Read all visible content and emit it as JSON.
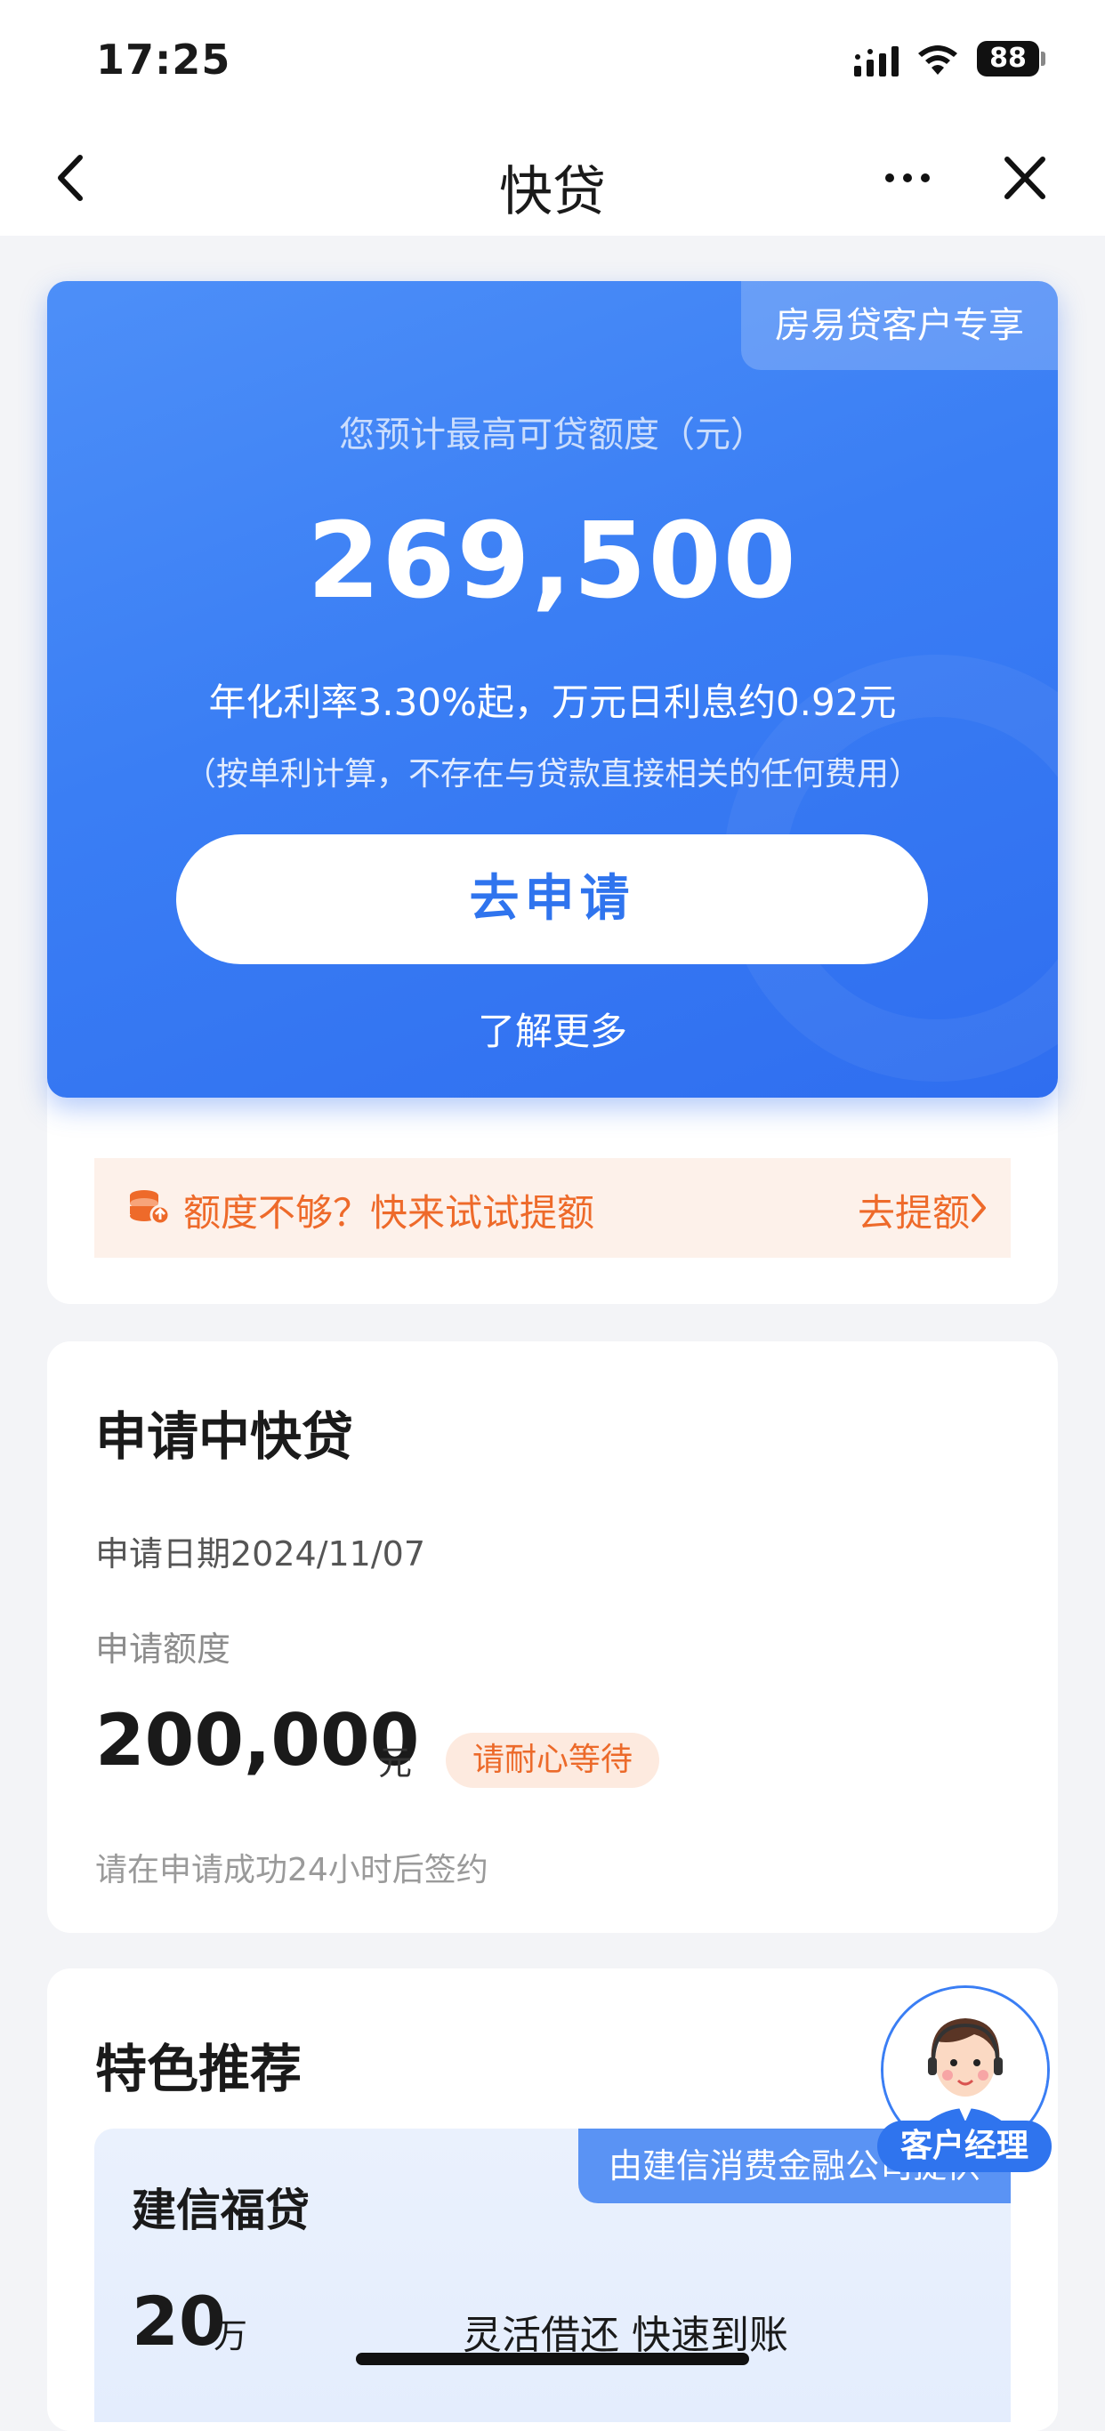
{
  "status_bar": {
    "time": "17:25",
    "battery": "88"
  },
  "nav": {
    "title": "快贷",
    "back_icon": "chevron-left-icon",
    "more_icon": "more-dots-icon",
    "close_icon": "close-icon"
  },
  "quota_card": {
    "tag": "房易贷客户专享",
    "label": "您预计最高可贷额度（元）",
    "amount": "269,500",
    "rate_line": "年化利率3.30%起，万元日利息约0.92元",
    "rate_note": "（按单利计算，不存在与贷款直接相关的任何费用）",
    "apply_button": "去申请",
    "learn_more": "了解更多"
  },
  "raise_bar": {
    "text": "额度不够？快来试试提额",
    "link": "去提额",
    "icon": "coin-stack-icon"
  },
  "applying": {
    "title": "申请中快贷",
    "date": "申请日期2024/11/07",
    "amount_label": "申请额度",
    "amount": "200,000",
    "unit": "元",
    "status": "请耐心等待",
    "note": "请在申请成功24小时后签约"
  },
  "featured": {
    "title": "特色推荐",
    "product": {
      "name": "建信福贷",
      "provider": "由建信消费金融公司提供",
      "amount": "20",
      "unit": "万",
      "slogan": "灵活借还 快速到账"
    }
  },
  "customer_manager": {
    "label": "客户经理"
  },
  "colors": {
    "primary": "#2f74ee",
    "accent_orange": "#ee6a2a"
  }
}
